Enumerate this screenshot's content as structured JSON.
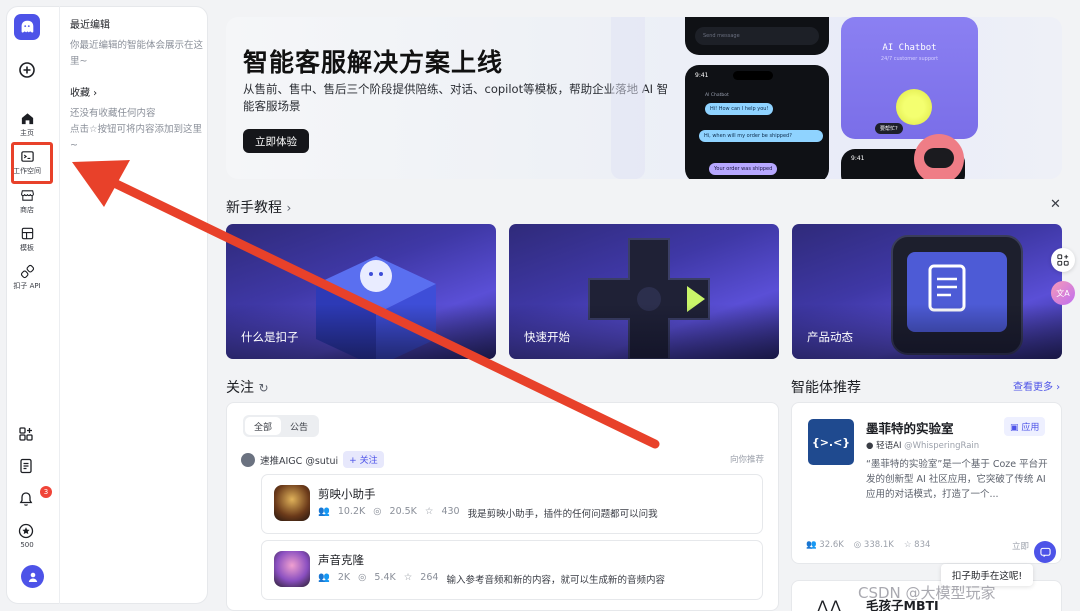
{
  "rail": {
    "items": [
      {
        "label": "主页",
        "icon": "home-icon"
      },
      {
        "label": "工作空间",
        "icon": "terminal-icon"
      },
      {
        "label": "商店",
        "icon": "store-icon"
      },
      {
        "label": "模板",
        "icon": "template-icon"
      },
      {
        "label": "扣子 API",
        "icon": "link-icon"
      }
    ],
    "notification_count": "3",
    "points": "500"
  },
  "panel": {
    "recent_title": "最近编辑",
    "recent_text": "你最近编辑的智能体会展示在这里~",
    "fav_title": "收藏 ›",
    "fav_text_1": "还没有收藏任何内容",
    "fav_text_2": "点击☆按钮可将内容添加到这里~"
  },
  "banner": {
    "title": "智能客服解决方案上线",
    "subtitle": "从售前、售中、售后三个阶段提供陪练、对话、copilot等模板，帮助企业落地 AI 智能客服场景",
    "button": "立即体验",
    "chat": {
      "time": "9:41",
      "bot_name": "AI Chatbot",
      "msg1": "Hi! How can I help you!",
      "msg2": "Hi, when will my order be shipped?",
      "msg3": "Your order was shipped",
      "card_title": "AI Chatbot",
      "card_sub": "24/7 customer support",
      "bubble": "要帮忙?",
      "send_placeholder": "Send message"
    }
  },
  "tutorials": {
    "title": "新手教程",
    "cards": [
      {
        "label": "什么是扣子"
      },
      {
        "label": "快速开始"
      },
      {
        "label": "产品动态"
      }
    ]
  },
  "follow": {
    "title": "关注",
    "tabs": [
      "全部",
      "公告"
    ],
    "user": "速推AIGC @sutui",
    "follow_button": "+ 关注",
    "recommend": "向你推荐",
    "items": [
      {
        "name": "剪映小助手",
        "users": "10.2K",
        "chats": "20.5K",
        "stars": "430",
        "desc": "我是剪映小助手，插件的任何问题都可以问我"
      },
      {
        "name": "声音克隆",
        "users": "2K",
        "chats": "5.4K",
        "stars": "264",
        "desc": "输入参考音频和新的内容，就可以生成新的音频内容"
      }
    ]
  },
  "agents": {
    "title": "智能体推荐",
    "see_more": "查看更多 ›",
    "cards": [
      {
        "icon_text": "{>.<}",
        "name": "墨菲特的实验室",
        "tag": "应用",
        "author": "轻语AI",
        "handle": "@WhisperingRain",
        "desc": "“墨菲特的实验室”是一个基于 Coze 平台开发的创新型 AI 社区应用，它突破了传统 AI 应用的对话模式，打造了一个...",
        "users": "32.6K",
        "chats": "338.1K",
        "stars": "834",
        "extra": "立即"
      },
      {
        "name": "毛孩子MBTI"
      }
    ]
  },
  "helper": {
    "text": "扣子助手在这呢!"
  },
  "watermark": "CSDN @大模型玩家",
  "colors": {
    "accent": "#4d53e8",
    "annotation_red": "#e8412a",
    "badge_red": "#f04438"
  }
}
